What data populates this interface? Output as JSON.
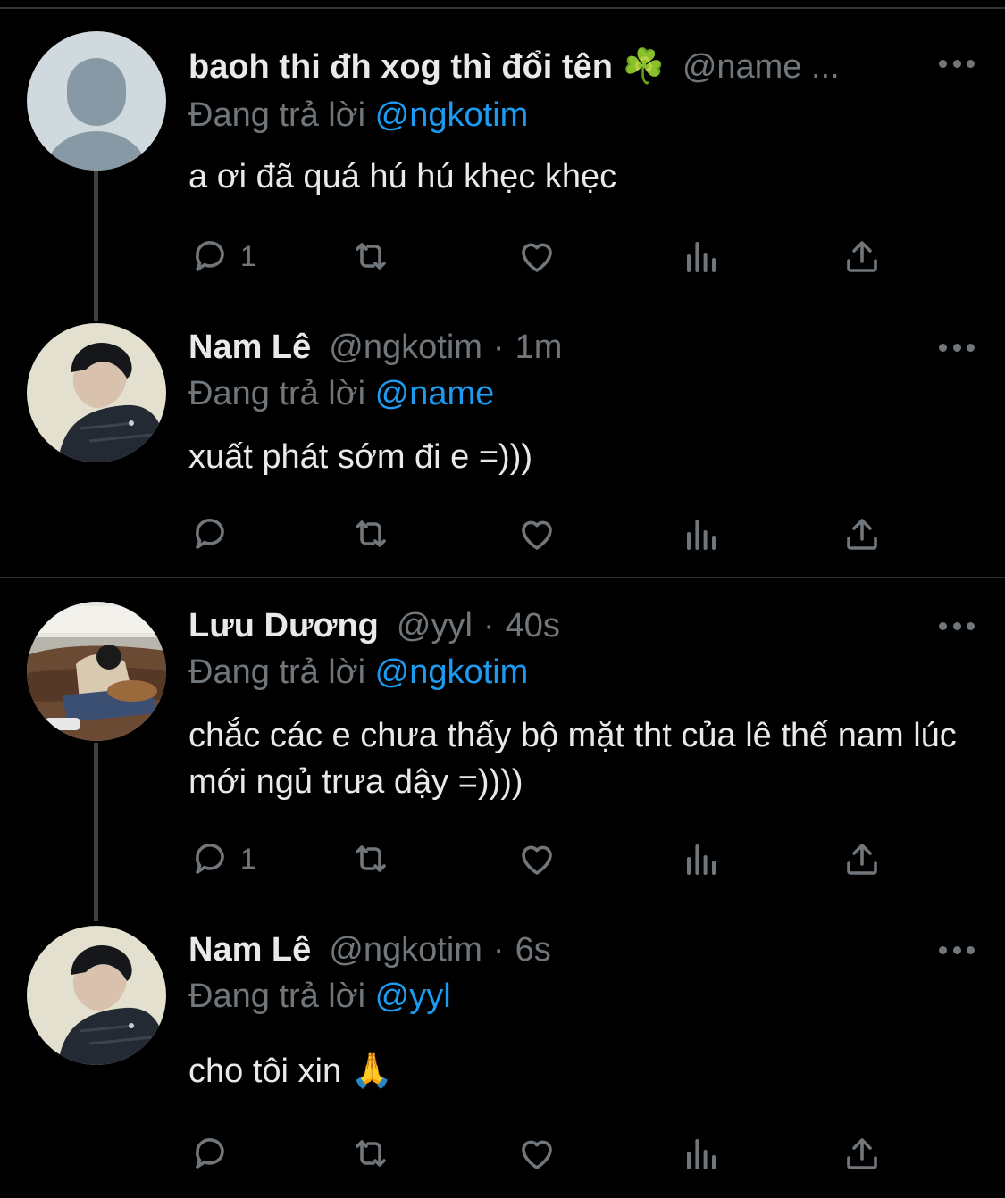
{
  "tweets": [
    {
      "name": "baoh thi đh xog thì đổi tên ☘️",
      "handle": "@name ...",
      "dot": "",
      "time": "",
      "replying_prefix": "Đang trả lời",
      "replying_to": "@ngkotim",
      "text": "a ơi đã quá hú hú khẹc khẹc",
      "reply_count": "1"
    },
    {
      "name": "Nam Lê",
      "handle": "@ngkotim",
      "dot": "·",
      "time": "1m",
      "replying_prefix": "Đang trả lời",
      "replying_to": "@name",
      "text": "xuất phát sớm đi e =)))",
      "reply_count": ""
    },
    {
      "name": "Lưu Dương",
      "handle": "@yyl",
      "dot": "·",
      "time": "40s",
      "replying_prefix": "Đang trả lời",
      "replying_to": "@ngkotim",
      "text": "chắc các e chưa thấy bộ mặt tht của lê thế nam lúc mới ngủ trưa dậy =))))",
      "reply_count": "1"
    },
    {
      "name": "Nam Lê",
      "handle": "@ngkotim",
      "dot": "·",
      "time": "6s",
      "replying_prefix": "Đang trả lời",
      "replying_to": "@yyl",
      "text": "cho tôi xin 🙏",
      "reply_count": ""
    }
  ],
  "icons": {
    "reply": "reply-icon",
    "retweet": "retweet-icon",
    "like": "like-icon",
    "views": "views-icon",
    "share": "share-icon",
    "more": "more-icon"
  },
  "colors": {
    "background": "#000000",
    "text": "#e7e9ea",
    "muted": "#71767b",
    "mention": "#1d9bf0",
    "thread_line": "#3e4144",
    "separator": "#2f3336"
  }
}
